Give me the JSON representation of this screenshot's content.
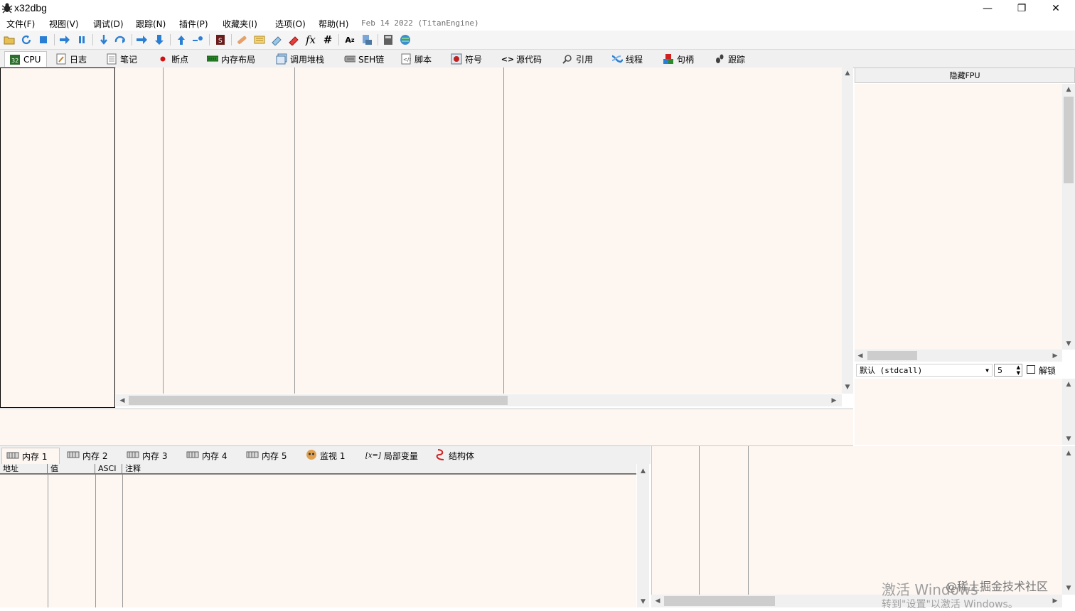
{
  "window": {
    "title": "x32dbg",
    "minimize": "—",
    "restore": "❐",
    "close": "✕"
  },
  "menu": {
    "items": [
      "文件(F)",
      "视图(V)",
      "调试(D)",
      "跟踪(N)",
      "插件(P)",
      "收藏夹(I)",
      "选项(O)",
      "帮助(H)"
    ],
    "date": "Feb 14 2022 (TitanEngine)"
  },
  "tabs": [
    {
      "label": "CPU",
      "icon": "cpu-icon"
    },
    {
      "label": "日志",
      "icon": "log-icon"
    },
    {
      "label": "笔记",
      "icon": "notes-icon"
    },
    {
      "label": "断点",
      "icon": "breakpoint-dot-icon"
    },
    {
      "label": "内存布局",
      "icon": "memory-map-icon"
    },
    {
      "label": "调用堆栈",
      "icon": "call-stack-icon"
    },
    {
      "label": "SEH链",
      "icon": "seh-chain-icon"
    },
    {
      "label": "脚本",
      "icon": "script-icon"
    },
    {
      "label": "符号",
      "icon": "symbols-icon"
    },
    {
      "label": "源代码",
      "icon": "source-code-icon"
    },
    {
      "label": "引用",
      "icon": "references-icon"
    },
    {
      "label": "线程",
      "icon": "threads-icon"
    },
    {
      "label": "句柄",
      "icon": "handles-icon"
    },
    {
      "label": "跟踪",
      "icon": "trace-icon"
    }
  ],
  "registers": {
    "hide_fpu": "隐藏FPU",
    "call_convention": "默认 (stdcall)",
    "arg_count": "5",
    "unlock_label": "解锁"
  },
  "dump_tabs": [
    {
      "label": "内存 1",
      "icon": "memory-dump-icon"
    },
    {
      "label": "内存 2",
      "icon": "memory-dump-icon"
    },
    {
      "label": "内存 3",
      "icon": "memory-dump-icon"
    },
    {
      "label": "内存 4",
      "icon": "memory-dump-icon"
    },
    {
      "label": "内存 5",
      "icon": "memory-dump-icon"
    },
    {
      "label": "监视 1",
      "icon": "watch-icon"
    },
    {
      "label": "局部变量",
      "icon": "locals-icon"
    },
    {
      "label": "结构体",
      "icon": "struct-icon"
    }
  ],
  "dump_columns": [
    "地址",
    "值",
    "ASCI",
    "注释"
  ],
  "watermark": {
    "line1": "激活 Windows",
    "line2": "转到\"设置\"以激活 Windows。",
    "site": "@稀土掘金技术社区"
  },
  "colors": {
    "pane_bg": "#fdf6f1",
    "toolbar_bg": "#f5f5f5",
    "tab_bg": "#f0f0f0"
  }
}
